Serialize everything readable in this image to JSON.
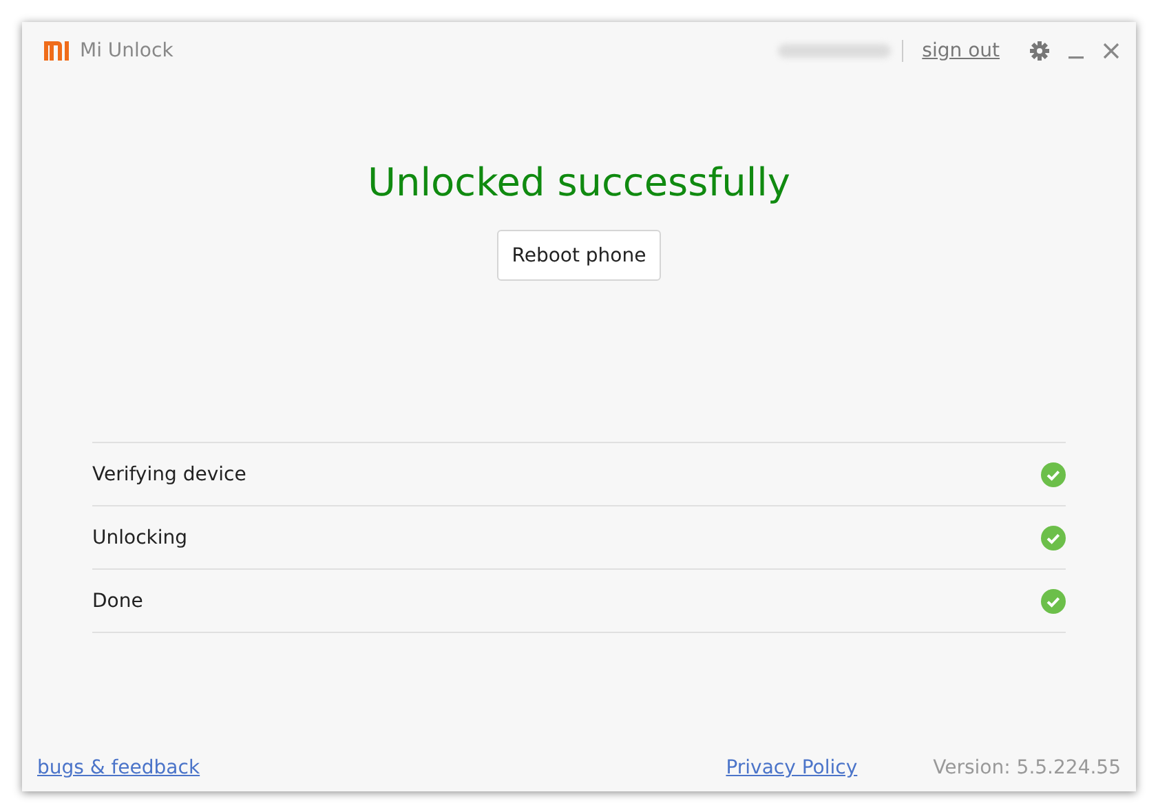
{
  "window": {
    "title": "Mi Unlock"
  },
  "header": {
    "sign_out": "sign out"
  },
  "status": {
    "title": "Unlocked successfully"
  },
  "reboot_button": "Reboot phone",
  "steps": [
    {
      "label": "Verifying device",
      "done": true
    },
    {
      "label": "Unlocking",
      "done": true
    },
    {
      "label": "Done",
      "done": true
    }
  ],
  "footer": {
    "feedback_link": "bugs & feedback",
    "privacy_link": "Privacy Policy",
    "version": "Version: 5.5.224.55"
  }
}
